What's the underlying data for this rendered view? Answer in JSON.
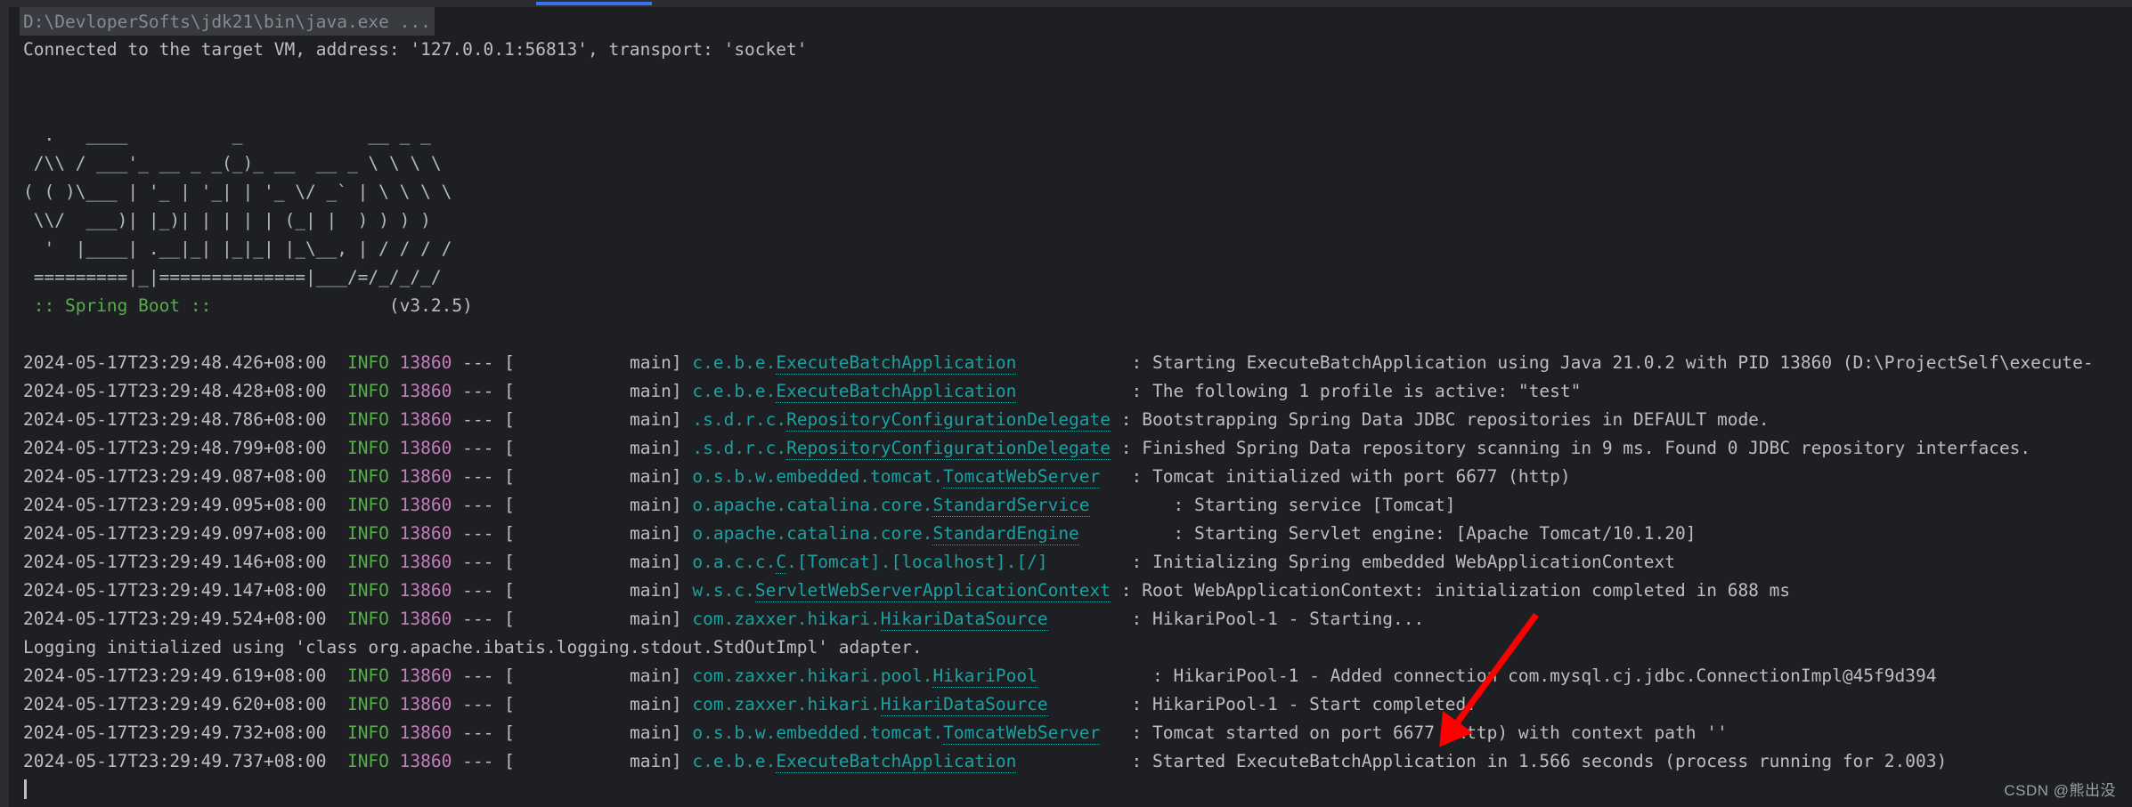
{
  "window": {
    "tab_indicator_color": "#3574f0",
    "background_color": "#1e1f22",
    "gutter_color": "#2b2d30"
  },
  "console": {
    "command_line": "D:\\DevloperSofts\\jdk21\\bin\\java.exe ...",
    "connected_line": "Connected to the target VM, address: '127.0.0.1:56813', transport: 'socket'",
    "banner": {
      "line1": "  .   ____          _            __ _ _",
      "line2": " /\\\\ / ___'_ __ _ _(_)_ __  __ _ \\ \\ \\ \\",
      "line3": "( ( )\\___ | '_ | '_| | '_ \\/ _` | \\ \\ \\ \\",
      "line4": " \\\\/  ___)| |_)| | | | | (_| |  ) ) ) )",
      "line5": "  '  |____| .__|_| |_|_| |_\\__, | / / / /",
      "line6": " =========|_|==============|___/=/_/_/_/",
      "label": " :: Spring Boot :: ",
      "version": "                (v3.2.5)",
      "label_color": "#5aab4d"
    },
    "plain_lines": [
      {
        "text": "Logging initialized using 'class org.apache.ibatis.logging.stdout.StdOutImpl' adapter.",
        "index": 10
      }
    ],
    "log_lines": [
      {
        "timestamp": "2024-05-17T23:29:48.426+08:00",
        "level": "INFO",
        "pid": "13860",
        "separator": "---",
        "thread": "[           main]",
        "logger": "c.e.b.e.",
        "logger_class": "ExecuteBatchApplication",
        "logger_pad": "          ",
        "message": ": Starting ExecuteBatchApplication using Java 21.0.2 with PID 13860 (D:\\ProjectSelf\\execute-"
      },
      {
        "timestamp": "2024-05-17T23:29:48.428+08:00",
        "level": "INFO",
        "pid": "13860",
        "separator": "---",
        "thread": "[           main]",
        "logger": "c.e.b.e.",
        "logger_class": "ExecuteBatchApplication",
        "logger_pad": "          ",
        "message": ": The following 1 profile is active: \"test\""
      },
      {
        "timestamp": "2024-05-17T23:29:48.786+08:00",
        "level": "INFO",
        "pid": "13860",
        "separator": "---",
        "thread": "[           main]",
        "logger": ".s.d.r.c.",
        "logger_class": "RepositoryConfigurationDelegate",
        "logger_pad": "",
        "message": ": Bootstrapping Spring Data JDBC repositories in DEFAULT mode."
      },
      {
        "timestamp": "2024-05-17T23:29:48.799+08:00",
        "level": "INFO",
        "pid": "13860",
        "separator": "---",
        "thread": "[           main]",
        "logger": ".s.d.r.c.",
        "logger_class": "RepositoryConfigurationDelegate",
        "logger_pad": "",
        "message": ": Finished Spring Data repository scanning in 9 ms. Found 0 JDBC repository interfaces."
      },
      {
        "timestamp": "2024-05-17T23:29:49.087+08:00",
        "level": "INFO",
        "pid": "13860",
        "separator": "---",
        "thread": "[           main]",
        "logger": "o.s.b.w.embedded.tomcat.",
        "logger_class": "TomcatWebServer",
        "logger_pad": "  ",
        "message": ": Tomcat initialized with port 6677 (http)"
      },
      {
        "timestamp": "2024-05-17T23:29:49.095+08:00",
        "level": "INFO",
        "pid": "13860",
        "separator": "---",
        "thread": "[           main]",
        "logger": "o.apache.catalina.core.",
        "logger_class": "StandardService",
        "logger_pad": "       ",
        "message": ": Starting service [Tomcat]"
      },
      {
        "timestamp": "2024-05-17T23:29:49.097+08:00",
        "level": "INFO",
        "pid": "13860",
        "separator": "---",
        "thread": "[           main]",
        "logger": "o.apache.catalina.core.",
        "logger_class": "StandardEngine",
        "logger_pad": "        ",
        "message": ": Starting Servlet engine: [Apache Tomcat/10.1.20]"
      },
      {
        "timestamp": "2024-05-17T23:29:49.146+08:00",
        "level": "INFO",
        "pid": "13860",
        "separator": "---",
        "thread": "[           main]",
        "logger": "o.a.c.c.",
        "logger_class": "C",
        "logger_suffix": ".[Tomcat].[localhost].[/]",
        "logger_pad": "       ",
        "message": ": Initializing Spring embedded WebApplicationContext"
      },
      {
        "timestamp": "2024-05-17T23:29:49.147+08:00",
        "level": "INFO",
        "pid": "13860",
        "separator": "---",
        "thread": "[           main]",
        "logger": "w.s.c.",
        "logger_class": "ServletWebServerApplicationContext",
        "logger_pad": "",
        "message": ": Root WebApplicationContext: initialization completed in 688 ms"
      },
      {
        "timestamp": "2024-05-17T23:29:49.524+08:00",
        "level": "INFO",
        "pid": "13860",
        "separator": "---",
        "thread": "[           main]",
        "logger": "com.zaxxer.hikari.",
        "logger_class": "HikariDataSource",
        "logger_pad": "       ",
        "message": ": HikariPool-1 - Starting..."
      },
      {
        "timestamp": "2024-05-17T23:29:49.619+08:00",
        "level": "INFO",
        "pid": "13860",
        "separator": "---",
        "thread": "[           main]",
        "logger": "com.zaxxer.hikari.pool.",
        "logger_class": "HikariPool",
        "logger_pad": "          ",
        "message": ": HikariPool-1 - Added connection com.mysql.cj.jdbc.ConnectionImpl@45f9d394"
      },
      {
        "timestamp": "2024-05-17T23:29:49.620+08:00",
        "level": "INFO",
        "pid": "13860",
        "separator": "---",
        "thread": "[           main]",
        "logger": "com.zaxxer.hikari.",
        "logger_class": "HikariDataSource",
        "logger_pad": "       ",
        "message": ": HikariPool-1 - Start completed."
      },
      {
        "timestamp": "2024-05-17T23:29:49.732+08:00",
        "level": "INFO",
        "pid": "13860",
        "separator": "---",
        "thread": "[           main]",
        "logger": "o.s.b.w.embedded.tomcat.",
        "logger_class": "TomcatWebServer",
        "logger_pad": "  ",
        "message": ": Tomcat started on port 6677 (http) with context path ''"
      },
      {
        "timestamp": "2024-05-17T23:29:49.737+08:00",
        "level": "INFO",
        "pid": "13860",
        "separator": "---",
        "thread": "[           main]",
        "logger": "c.e.b.e.",
        "logger_class": "ExecuteBatchApplication",
        "logger_pad": "          ",
        "message": ": Started ExecuteBatchApplication in 1.566 seconds (process running for 2.003)"
      }
    ]
  },
  "annotation": {
    "arrow_color": "#fe0000",
    "points_to": "6677"
  },
  "watermark": {
    "text": "CSDN @熊出没"
  }
}
